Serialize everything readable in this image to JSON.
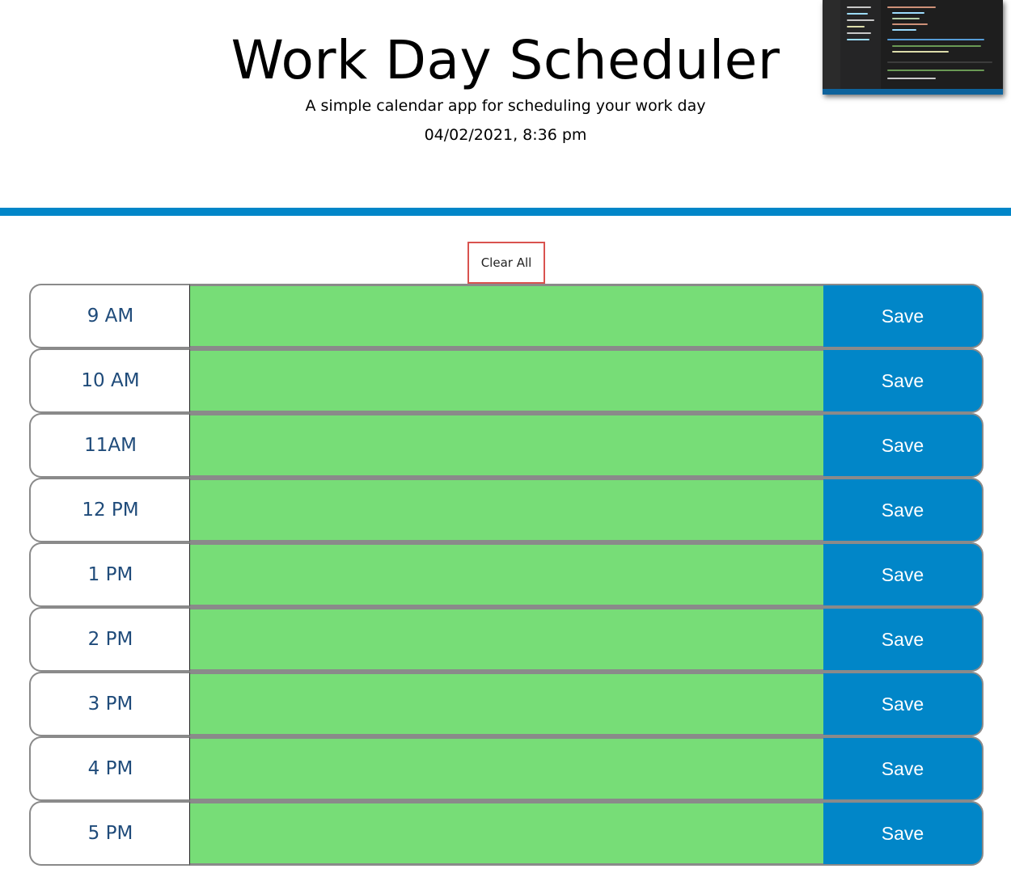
{
  "header": {
    "title": "Work Day Scheduler",
    "subtitle": "A simple calendar app for scheduling your work day",
    "current_datetime": "04/02/2021, 8:36 pm"
  },
  "actions": {
    "clear_all_label": "Clear All"
  },
  "colors": {
    "accent": "#0186c8",
    "present_block": "#77dd77",
    "clear_border": "#d9534f",
    "hour_text": "#1f4b7a"
  },
  "schedule": [
    {
      "hour": "9 AM",
      "event": "",
      "save_label": "Save"
    },
    {
      "hour": "10 AM",
      "event": "",
      "save_label": "Save"
    },
    {
      "hour": "11AM",
      "event": "",
      "save_label": "Save"
    },
    {
      "hour": "12 PM",
      "event": "",
      "save_label": "Save"
    },
    {
      "hour": "1 PM",
      "event": "",
      "save_label": "Save"
    },
    {
      "hour": "2 PM",
      "event": "",
      "save_label": "Save"
    },
    {
      "hour": "3 PM",
      "event": "",
      "save_label": "Save"
    },
    {
      "hour": "4 PM",
      "event": "",
      "save_label": "Save"
    },
    {
      "hour": "5 PM",
      "event": "",
      "save_label": "Save"
    }
  ]
}
